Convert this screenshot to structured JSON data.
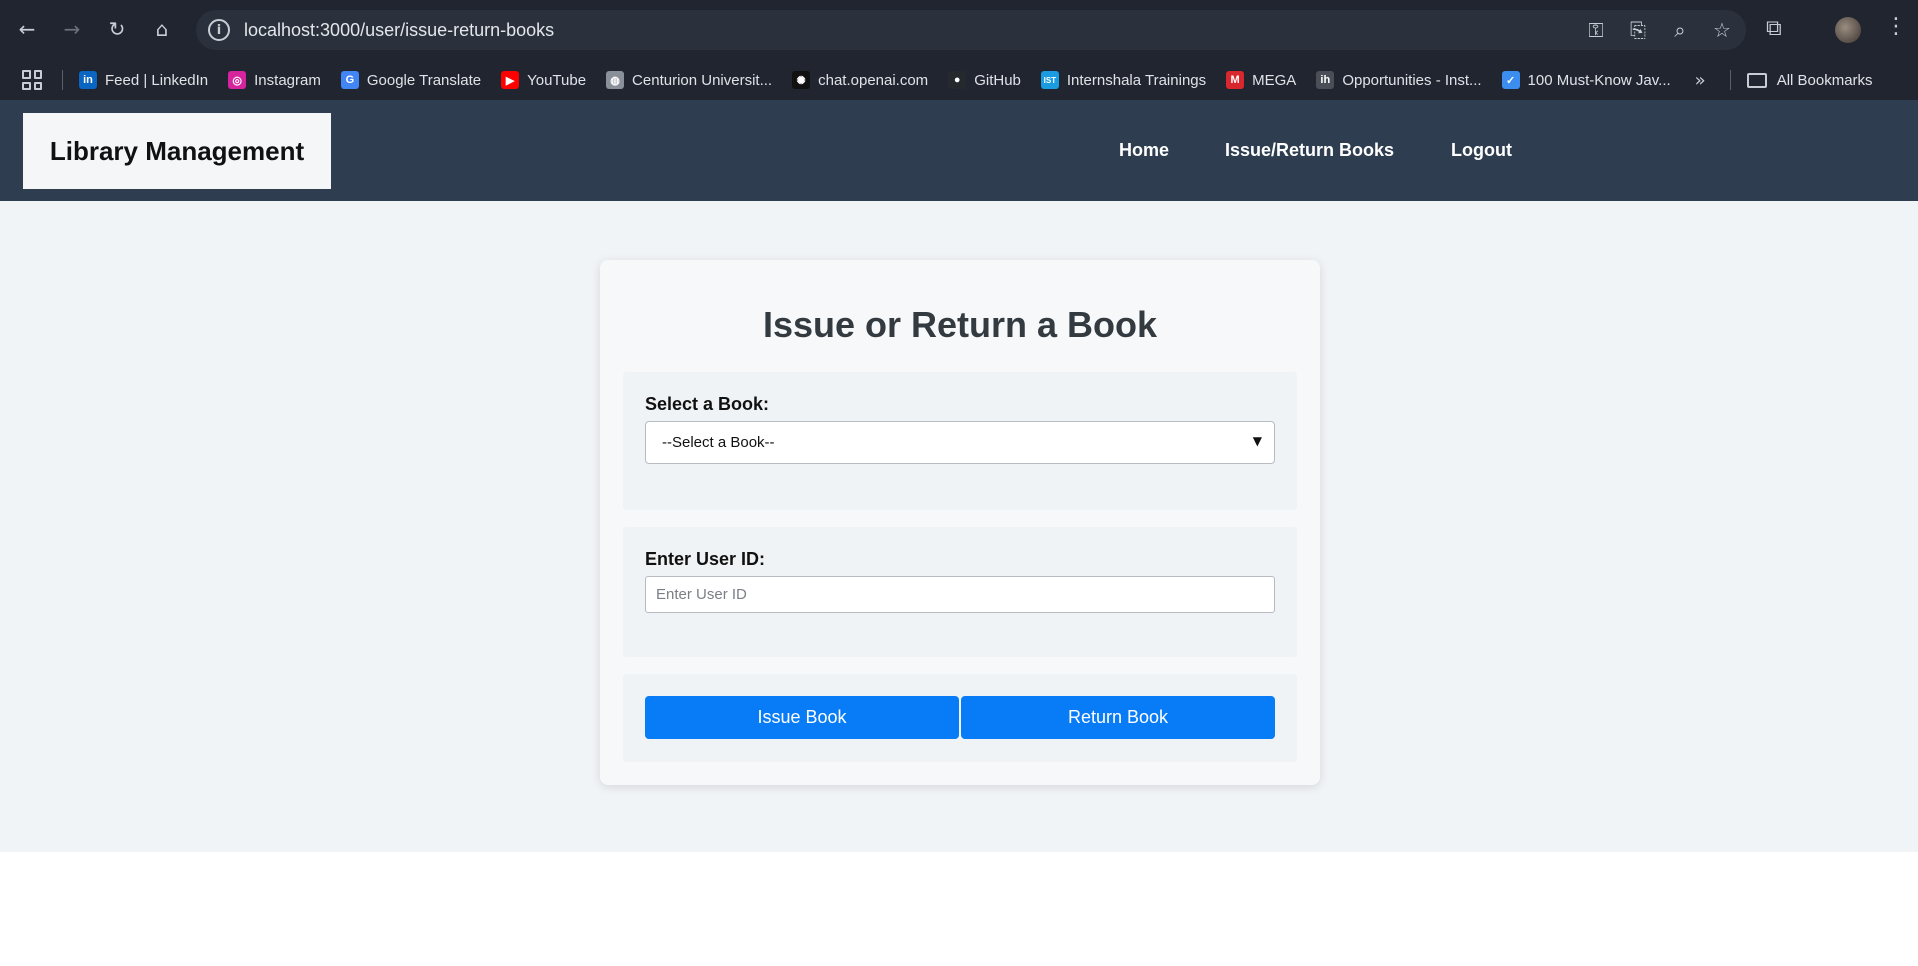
{
  "browser": {
    "url": "localhost:3000/user/issue-return-books",
    "bookmarks": [
      {
        "label": "Feed | LinkedIn",
        "icon": "linkedin-icon",
        "color": "#0a66c2",
        "glyph": "in"
      },
      {
        "label": "Instagram",
        "icon": "instagram-icon",
        "color": "#d6249f",
        "glyph": "◎"
      },
      {
        "label": "Google Translate",
        "icon": "google-translate-icon",
        "color": "#4285f4",
        "glyph": "G"
      },
      {
        "label": "YouTube",
        "icon": "youtube-icon",
        "color": "#ff0000",
        "glyph": "▶"
      },
      {
        "label": "Centurion Universit...",
        "icon": "globe-icon",
        "color": "#8a9099",
        "glyph": "◍"
      },
      {
        "label": "chat.openai.com",
        "icon": "openai-icon",
        "color": "#111111",
        "glyph": "✺"
      },
      {
        "label": "GitHub",
        "icon": "github-icon",
        "color": "#24292e",
        "glyph": "●"
      },
      {
        "label": "Internshala Trainings",
        "icon": "internshala-icon",
        "color": "#1a9de0",
        "glyph": "IST"
      },
      {
        "label": "MEGA",
        "icon": "mega-icon",
        "color": "#d9272e",
        "glyph": "M"
      },
      {
        "label": "Opportunities - Inst...",
        "icon": "instahyre-icon",
        "color": "#4a4f57",
        "glyph": "ih"
      },
      {
        "label": "100 Must-Know Jav...",
        "icon": "verified-icon",
        "color": "#3b8ef0",
        "glyph": "✓"
      }
    ],
    "all_bookmarks_label": "All Bookmarks"
  },
  "header": {
    "brand": "Library Management",
    "nav": {
      "home": "Home",
      "issue_return": "Issue/Return Books",
      "logout": "Logout"
    }
  },
  "form": {
    "title": "Issue or Return a Book",
    "book_label": "Select a Book:",
    "book_selected": "--Select a Book--",
    "user_label": "Enter User ID:",
    "user_placeholder": "Enter User ID",
    "user_value": "",
    "issue_button": "Issue Book",
    "return_button": "Return Book"
  },
  "colors": {
    "header_bg": "#2e3e50",
    "page_bg": "#f1f4f7",
    "button": "#087cf7"
  }
}
